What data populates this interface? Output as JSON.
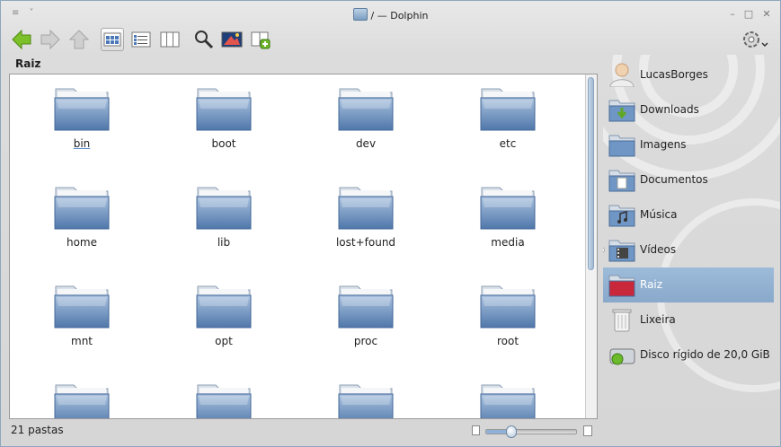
{
  "window": {
    "title": "/ — Dolphin",
    "menu_glyph": "≡ ˅"
  },
  "toolbar": {
    "buttons": [
      {
        "name": "back-button",
        "icon": "arrow-left-icon"
      },
      {
        "name": "forward-button",
        "icon": "arrow-right-icon"
      },
      {
        "name": "up-button",
        "icon": "arrow-up-icon"
      },
      {
        "name": "icons-view-button",
        "icon": "icons-view-icon",
        "active": true
      },
      {
        "name": "details-view-button",
        "icon": "details-view-icon"
      },
      {
        "name": "columns-view-button",
        "icon": "columns-view-icon"
      },
      {
        "name": "search-button",
        "icon": "search-icon"
      },
      {
        "name": "preview-button",
        "icon": "preview-icon"
      },
      {
        "name": "split-button",
        "icon": "split-view-icon"
      }
    ],
    "settings_icon": "gear-icon"
  },
  "location": {
    "label": "Raiz"
  },
  "files": [
    {
      "label": "bin"
    },
    {
      "label": "boot"
    },
    {
      "label": "dev"
    },
    {
      "label": "etc"
    },
    {
      "label": "home"
    },
    {
      "label": "lib"
    },
    {
      "label": "lost+found"
    },
    {
      "label": "media"
    },
    {
      "label": "mnt"
    },
    {
      "label": "opt"
    },
    {
      "label": "proc"
    },
    {
      "label": "root"
    },
    {
      "label": ""
    },
    {
      "label": ""
    },
    {
      "label": ""
    },
    {
      "label": ""
    }
  ],
  "status": {
    "text": "21 pastas",
    "zoom_level": 0.28
  },
  "places": [
    {
      "label": "LucasBorges",
      "icon": "user-icon"
    },
    {
      "label": "Downloads",
      "icon": "downloads-folder-icon"
    },
    {
      "label": "Imagens",
      "icon": "images-folder-icon"
    },
    {
      "label": "Documentos",
      "icon": "documents-folder-icon"
    },
    {
      "label": "Música",
      "icon": "music-folder-icon"
    },
    {
      "label": "Vídeos",
      "icon": "videos-folder-icon"
    },
    {
      "label": "Raiz",
      "icon": "root-folder-icon",
      "selected": true
    },
    {
      "label": "Lixeira",
      "icon": "trash-icon"
    },
    {
      "label": "Disco rígido de 20,0 GiB",
      "icon": "hard-disk-icon"
    }
  ],
  "colors": {
    "accent": "#89a9cb",
    "folder": "#6f96c4",
    "back_arrow": "#7cc02a"
  }
}
